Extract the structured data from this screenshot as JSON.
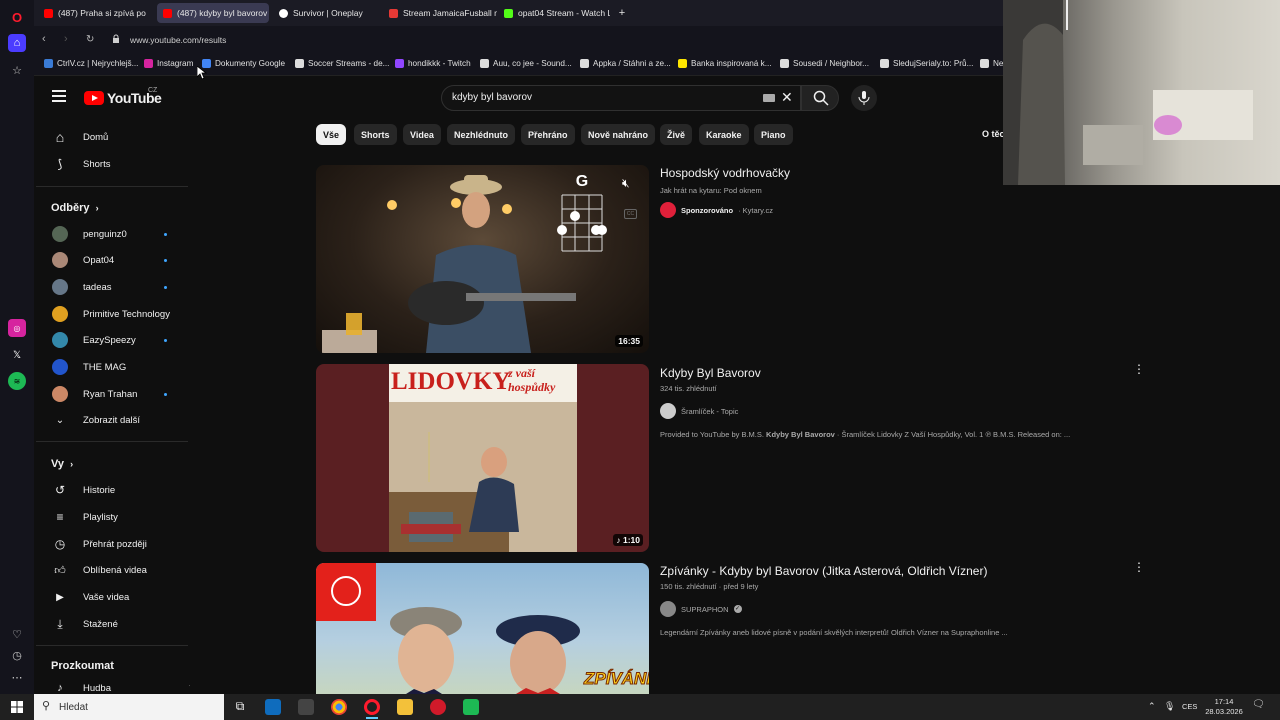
{
  "browser": {
    "tabs": [
      {
        "label": "(487) Praha si zpívá po",
        "color": "#ff0000"
      },
      {
        "label": "(487) kdyby byl bavorov",
        "color": "#ff0000",
        "active": true
      },
      {
        "label": "Survivor | Oneplay",
        "color": "#ffffff"
      },
      {
        "label": "Stream JamaicaFusball m",
        "color": "#e53935"
      },
      {
        "label": "opat04 Stream - Watch Li",
        "color": "#53fc18"
      }
    ],
    "new_tab": "+",
    "url": "www.youtube.com/results",
    "bookmarks": [
      {
        "label": "CtrlV.cz | Nejrychlejš...",
        "color": "#3a7bd5"
      },
      {
        "label": "Instagram",
        "color": "#d6249f"
      },
      {
        "label": "Dokumenty Google",
        "color": "#4285f4"
      },
      {
        "label": "Soccer Streams - de...",
        "color": "#dddddd"
      },
      {
        "label": "hondikkk - Twitch",
        "color": "#9146ff"
      },
      {
        "label": "Auu, co jee - Sound...",
        "color": "#dddddd"
      },
      {
        "label": "Appka / Stáhni a ze...",
        "color": "#dddddd"
      },
      {
        "label": "Banka inspirovaná k...",
        "color": "#fee600"
      },
      {
        "label": "Sousedi / Neighbor...",
        "color": "#dddddd"
      },
      {
        "label": "SledujSerialy.to: Prů...",
        "color": "#dddddd"
      },
      {
        "label": "Ne",
        "color": "#dddddd"
      }
    ]
  },
  "youtube": {
    "logo_text": "YouTube",
    "region": "CZ",
    "search_value": "kdyby byl bavorov",
    "chips": [
      "Vše",
      "Shorts",
      "Videa",
      "Nezhlédnuto",
      "Přehráno",
      "Nově nahráno",
      "Živě",
      "Karaoke",
      "Piano"
    ],
    "chips_right": "O těc",
    "sidebar": {
      "home": "Domů",
      "shorts": "Shorts",
      "subs_header": "Odběry",
      "subscriptions": [
        {
          "name": "penguinz0",
          "color": "#556655",
          "new": true
        },
        {
          "name": "Opat04",
          "color": "#aa8877",
          "new": true
        },
        {
          "name": "tadeas",
          "color": "#667788",
          "new": true
        },
        {
          "name": "Primitive Technology",
          "color": "#e0a020",
          "new": false
        },
        {
          "name": "EazySpeezy",
          "color": "#3388aa",
          "new": true
        },
        {
          "name": "THE MAG",
          "color": "#2255cc",
          "new": false
        },
        {
          "name": "Ryan Trahan",
          "color": "#cc8866",
          "new": true
        }
      ],
      "show_more": "Zobrazit další",
      "you_header": "Vy",
      "you_items": [
        "Historie",
        "Playlisty",
        "Přehrát později",
        "Oblíbená videa",
        "Vaše videa",
        "Stažené"
      ],
      "explore_header": "Prozkoumat",
      "explore_items": [
        "Hudba"
      ]
    },
    "results": [
      {
        "title": "Hospodský vodrhovačky",
        "meta": "Jak hrát na kytaru: Pod oknem",
        "channel": "Sponzorováno",
        "channel_suffix": "· Kytary.cz",
        "duration": "16:35",
        "chord": "G"
      },
      {
        "title": "Kdyby Byl Bavorov",
        "meta": "324 tis. zhlédnutí",
        "channel": "Šramlíček - Topic",
        "desc_pre": "Provided to YouTube by B.M.S. ",
        "desc_bold": "Kdyby Byl Bavorov",
        "desc_post": " · Šramlíček Lidovky Z Vaší Hospůdky, Vol. 1 ℗ B.M.S. Released on: ...",
        "duration": "1:10",
        "thumb_title": "LIDOVKY",
        "thumb_subtitle": "z vaší hospůdky"
      },
      {
        "title": "Zpívánky - Kdyby byl Bavorov (Jitka Asterová, Oldřich Vízner)",
        "meta": "150 tis. zhlédnutí · před 9 lety",
        "channel": "SUPRAPHON",
        "desc": "Legendární Zpívánky aneb lidové písně v podání skvělých interpretů! Oldřich Vízner na Supraphonline ...",
        "thumb_title": "ZPÍVÁNKY"
      }
    ]
  },
  "taskbar": {
    "search_placeholder": "Hledat",
    "lang": "CES",
    "time": "17:14",
    "date": "28.03.2026"
  }
}
